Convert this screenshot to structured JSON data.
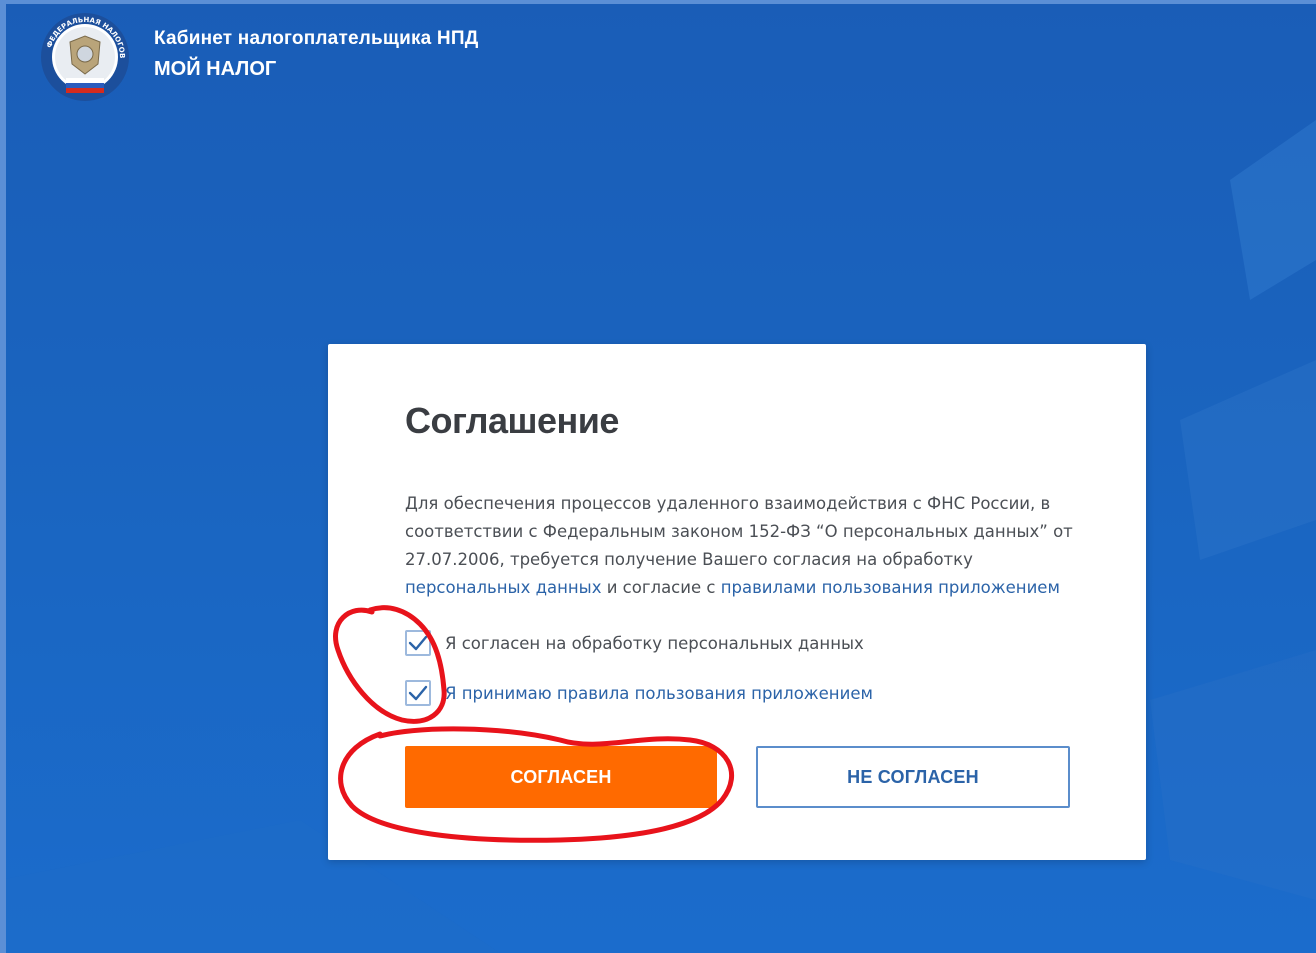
{
  "header": {
    "logo_text": "ФЕДЕРАЛЬНАЯ НАЛОГОВАЯ СЛУЖБА",
    "title_line1": "Кабинет налогоплательщика НПД",
    "title_line2": "МОЙ НАЛОГ"
  },
  "dialog": {
    "title": "Соглашение",
    "body_text": "Для обеспечения процессов удаленного взаимодействия с ФНС России, в соответствии с Федеральным законом 152-ФЗ “О персональных данных” от 27.07.2006, требуется получение Вашего согласия на обработку",
    "link_personal_data": "персональных данных",
    "body_text_and": "и согласие с",
    "link_rules": "правилами пользования приложением",
    "checkbox1_label": "Я согласен на обработку персональных данных",
    "checkbox1_checked": true,
    "checkbox2_label": "Я принимаю правила пользования приложением",
    "checkbox2_checked": true,
    "agree_button": "СОГЛАСЕН",
    "disagree_button": "НЕ СОГЛАСЕН"
  },
  "colors": {
    "background": "#1a64bf",
    "accent_orange": "#ff6a00",
    "link_blue": "#2b63a8",
    "annotation_red": "#e8131b"
  }
}
